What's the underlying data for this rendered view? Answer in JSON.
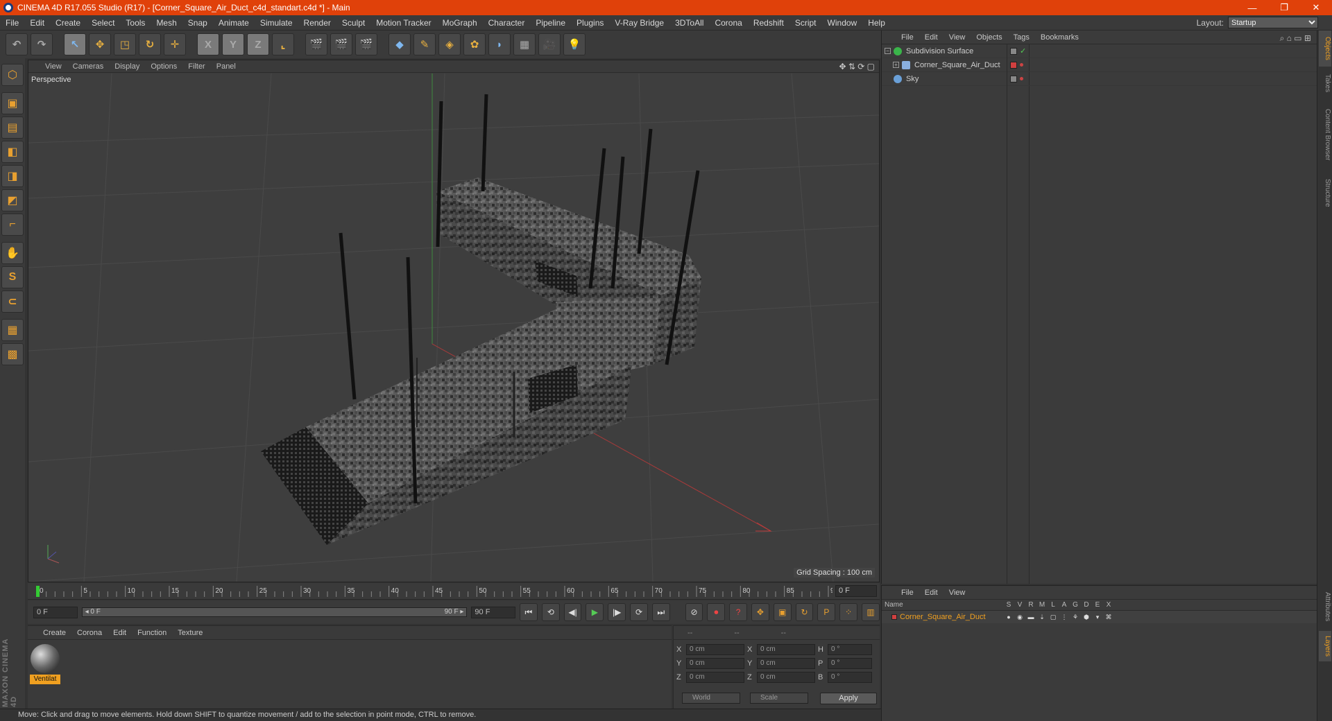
{
  "window": {
    "title": "CINEMA 4D R17.055 Studio (R17) - [Corner_Square_Air_Duct_c4d_standart.c4d *] - Main",
    "minimize": "—",
    "restore": "❐",
    "close": "✕"
  },
  "menu": [
    "File",
    "Edit",
    "Create",
    "Select",
    "Tools",
    "Mesh",
    "Snap",
    "Animate",
    "Simulate",
    "Render",
    "Sculpt",
    "Motion Tracker",
    "MoGraph",
    "Character",
    "Pipeline",
    "Plugins",
    "V-Ray Bridge",
    "3DToAll",
    "Corona",
    "Redshift",
    "Script",
    "Window",
    "Help"
  ],
  "layout": {
    "label": "Layout:",
    "value": "Startup"
  },
  "toolbar": {
    "undo": "↶",
    "redo": "↷",
    "select": "↖",
    "move": "✥",
    "scale": "◳",
    "rotate": "↻",
    "live": "✛",
    "x": "X",
    "y": "Y",
    "z": "Z",
    "coord": "⌞",
    "render_view": "🎬",
    "render_pic": "🎬",
    "render_settings": "🎬",
    "cube": "◆",
    "pen": "✎",
    "subdiv": "◈",
    "array": "✿",
    "deformer": "◗",
    "floor": "▦",
    "camera": "🎥",
    "light": "💡"
  },
  "lefttools": [
    "⬡",
    "▣",
    "▤",
    "◧",
    "◨",
    "◩",
    "⌐",
    "✋",
    "S",
    "⊂",
    "▦",
    "▩"
  ],
  "brand": "MAXON CINEMA 4D",
  "viewport": {
    "menu": [
      "View",
      "Cameras",
      "Display",
      "Options",
      "Filter",
      "Panel"
    ],
    "nav_icons": "✥ ⇅ ⟳ ▢",
    "label": "Perspective",
    "grid_spacing": "Grid Spacing : 100 cm"
  },
  "timeline": {
    "ticks": [
      "0",
      "5",
      "10",
      "15",
      "20",
      "25",
      "30",
      "35",
      "40",
      "45",
      "50",
      "55",
      "60",
      "65",
      "70",
      "75",
      "80",
      "85",
      "90"
    ],
    "current_frame": "0 F"
  },
  "playbar": {
    "start": "0 F",
    "slider_left": "◂ 0 F",
    "slider_right": "90 F ▸",
    "end": "90 F",
    "buttons": [
      "⏮",
      "⟲",
      "◀|",
      "▶",
      "|▶",
      "⟳",
      "⏭"
    ],
    "right_buttons": [
      "⊘",
      "⏺",
      "?",
      "✥",
      "▣",
      "↻",
      "P",
      "⁘",
      "▥"
    ]
  },
  "materials": {
    "menu": [
      "Create",
      "Corona",
      "Edit",
      "Function",
      "Texture"
    ],
    "items": [
      {
        "name": "Ventilat"
      }
    ]
  },
  "coordinates": {
    "header": [
      "--",
      "--",
      "--"
    ],
    "rows": [
      {
        "a": "X",
        "av": "0 cm",
        "b": "X",
        "bv": "0 cm",
        "c": "H",
        "cv": "0 °"
      },
      {
        "a": "Y",
        "av": "0 cm",
        "b": "Y",
        "bv": "0 cm",
        "c": "P",
        "cv": "0 °"
      },
      {
        "a": "Z",
        "av": "0 cm",
        "b": "Z",
        "bv": "0 cm",
        "c": "B",
        "cv": "0 °"
      }
    ],
    "mode1": "World",
    "mode2": "Scale",
    "apply": "Apply"
  },
  "status": "Move: Click and drag to move elements. Hold down SHIFT to quantize movement / add to the selection in point mode, CTRL to remove.",
  "objects": {
    "menu": [
      "File",
      "Edit",
      "View",
      "Objects",
      "Tags",
      "Bookmarks"
    ],
    "icons": "⌕ ⌂ ▭ ⊞",
    "items": [
      {
        "name": "Subdivision Surface",
        "icon_color": "#3ab54a",
        "check": "✓"
      },
      {
        "name": "Corner_Square_Air_Duct",
        "icon_color": "#8ab0e0"
      },
      {
        "name": "Sky",
        "icon_color": "#6aa0d8"
      }
    ]
  },
  "layers": {
    "menu": [
      "File",
      "Edit",
      "View"
    ],
    "headers": {
      "name": "Name",
      "cols": [
        "S",
        "V",
        "R",
        "M",
        "L",
        "A",
        "G",
        "D",
        "E",
        "X"
      ]
    },
    "row": {
      "name": "Corner_Square_Air_Duct",
      "cols": [
        "●",
        "◉",
        "▬",
        "⇣",
        "▢",
        "⋮",
        "⚘",
        "⬢",
        "▾",
        "⌘"
      ]
    }
  },
  "righttabs": [
    "Objects",
    "Takes",
    "Content Browser",
    "Structure",
    "Attributes",
    "Layers"
  ],
  "colors": {
    "titlebar": "#e0410a",
    "accent": "#f0a020"
  }
}
